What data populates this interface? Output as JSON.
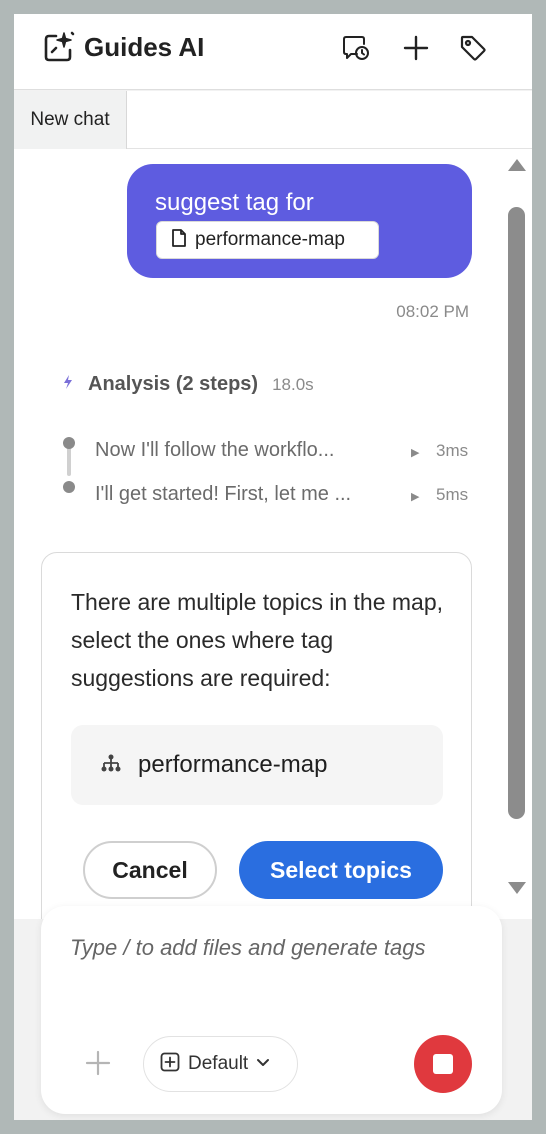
{
  "header": {
    "app_title": "Guides AI",
    "logo_icon": "sparkle-image-icon",
    "actions": [
      {
        "name": "chat-history-icon"
      },
      {
        "name": "new-chat-plus-icon"
      },
      {
        "name": "tag-icon"
      }
    ]
  },
  "tabs": [
    {
      "label": "New chat",
      "active": true
    }
  ],
  "conversation": {
    "user_message": {
      "text": "suggest tag for",
      "attachment": {
        "label": "performance-map",
        "icon": "file-icon"
      },
      "timestamp": "08:02 PM"
    },
    "analysis": {
      "title": "Analysis (2 steps)",
      "duration": "18.0s",
      "steps": [
        {
          "text": "Now I'll follow the workflo...",
          "time": "3ms"
        },
        {
          "text": "I'll get started! First, let me ...",
          "time": "5ms"
        }
      ]
    },
    "assistant_card": {
      "message": "There are multiple topics in the map, select the ones where tag suggestions are required:",
      "topics": [
        {
          "label": "performance-map",
          "icon": "hierarchy-icon"
        }
      ],
      "cancel_label": "Cancel",
      "confirm_label": "Select topics"
    }
  },
  "composer": {
    "placeholder": "Type / to add files and generate tags",
    "value": "",
    "mode_label": "Default",
    "stop_icon": "stop-icon"
  },
  "colors": {
    "user_bubble": "#5e5ce0",
    "primary_button": "#2a6ee0",
    "stop_button": "#e0393e",
    "frame_background": "#b0b8b7"
  }
}
